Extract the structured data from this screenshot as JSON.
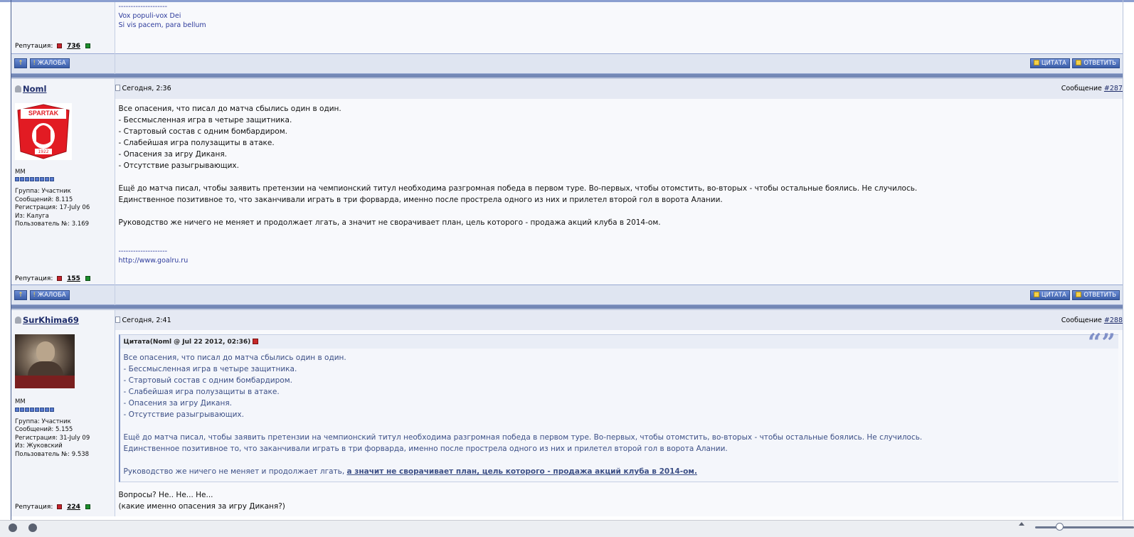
{
  "posts": [
    {
      "partial": true,
      "signature_lines": [
        "--------------------",
        "Vox populi-vox Dei",
        "Si vis pacem, para bellum"
      ],
      "reputation_label": "Репутация:",
      "reputation_value": "736"
    },
    {
      "author": "Noml",
      "date": "Сегодня, 2:36",
      "message_label": "Сообщение",
      "message_number": "#287",
      "title": "MM",
      "info": {
        "group": "Группа: Участник",
        "posts": "Сообщений: 8.115",
        "registered": "Регистрация: 17-July 06",
        "from": "Из: Калуга",
        "user_no": "Пользователь №: 3.169"
      },
      "body": [
        "Все опасения, что писал до матча сбылись один в один.",
        "- Бессмысленная игра в четыре защитника.",
        "- Стартовый состав с одним бомбардиром.",
        "- Слабейшая игра полузащиты в атаке.",
        "- Опасения за игру Диканя.",
        "- Отсутствие разыгрывающих.",
        "",
        "Ещё до матча писал, чтобы заявить претензии на чемпионский титул необходима разгромная победа в первом туре. Во-первых, чтобы отомстить, во-вторых - чтобы остальные боялись. Не случилось.",
        "Единственное позитивное то, что заканчивали играть в три форварда, именно после прострела одного из них и прилетел второй гол в ворота Алании.",
        "",
        "Руководство же ничего не меняет и продолжает лгать, а значит не сворачивает план, цель которого - продажа акций клуба в 2014-ом."
      ],
      "signature_lines": [
        "--------------------",
        "http://www.goalru.ru"
      ],
      "avatar_text": "SPARTAK",
      "avatar_year": "1922",
      "reputation_label": "Репутация:",
      "reputation_value": "155"
    },
    {
      "author": "SurKhima69",
      "date": "Сегодня, 2:41",
      "message_label": "Сообщение",
      "message_number": "#288",
      "title": "MM",
      "info": {
        "group": "Группа: Участник",
        "posts": "Сообщений: 5.155",
        "registered": "Регистрация: 31-July 09",
        "from": "Из: Жуковский",
        "user_no": "Пользователь №: 9.538"
      },
      "quote_header": "Цитата(Noml @ Jul 22 2012, 02:36)",
      "quote_lines": [
        "Все опасения, что писал до матча сбылись один в один.",
        "- Бессмысленная игра в четыре защитника.",
        "- Стартовый состав с одним бомбардиром.",
        "- Слабейшая игра полузащиты в атаке.",
        "- Опасения за игру Диканя.",
        "- Отсутствие разыгрывающих.",
        "",
        "Ещё до матча писал, чтобы заявить претензии на чемпионский титул необходима разгромная победа в первом туре. Во-первых, чтобы отомстить, во-вторых - чтобы остальные боялись. Не случилось.",
        "Единственное позитивное то, что заканчивали играть в три форварда, именно после прострела одного из них и прилетел второй гол в ворота Алании.",
        ""
      ],
      "quote_last_plain": "Руководство же ничего не меняет и продолжает лгать, ",
      "quote_last_bold": "а значит не сворачивает план, цель которого - продажа акций клуба в 2014-ом.",
      "body_after_quote": [
        "Вопросы? Не.. Не... Не...",
        "(какие именно опасения за игру Диканя?)"
      ],
      "reputation_label": "Репутация:",
      "reputation_value": "224"
    }
  ],
  "buttons": {
    "report": "ЖАЛОБА",
    "quote": "ЦИТАТА",
    "reply": "ОТВЕТИТЬ",
    "top_icon": "↑",
    "report_icon": "!"
  },
  "icons": {
    "rep_minus": "minus-icon",
    "rep_plus": "plus-icon",
    "quote_mark": "“”"
  }
}
